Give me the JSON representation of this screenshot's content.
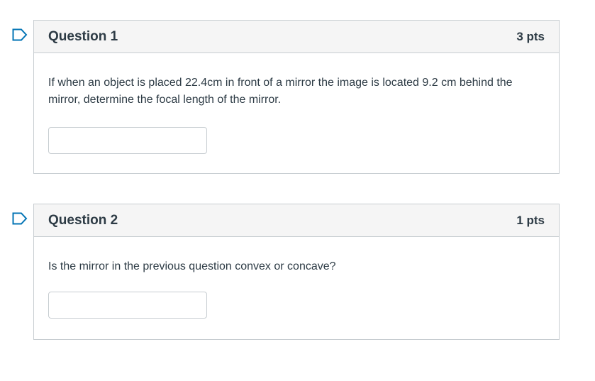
{
  "questions": [
    {
      "title": "Question 1",
      "points": "3 pts",
      "text": "If when an object is placed 22.4cm in front of a mirror the image is located 9.2 cm behind the mirror, determine the focal length of the mirror.",
      "answer_value": "",
      "flag_icon": "flag-bookmark-icon"
    },
    {
      "title": "Question 2",
      "points": "1 pts",
      "text": "Is the mirror in the previous question convex or concave?",
      "answer_value": "",
      "flag_icon": "flag-bookmark-icon"
    }
  ],
  "colors": {
    "flag": "#0374b5",
    "header_bg": "#f5f5f5",
    "border": "#c7cdd1",
    "text": "#2d3b45"
  }
}
